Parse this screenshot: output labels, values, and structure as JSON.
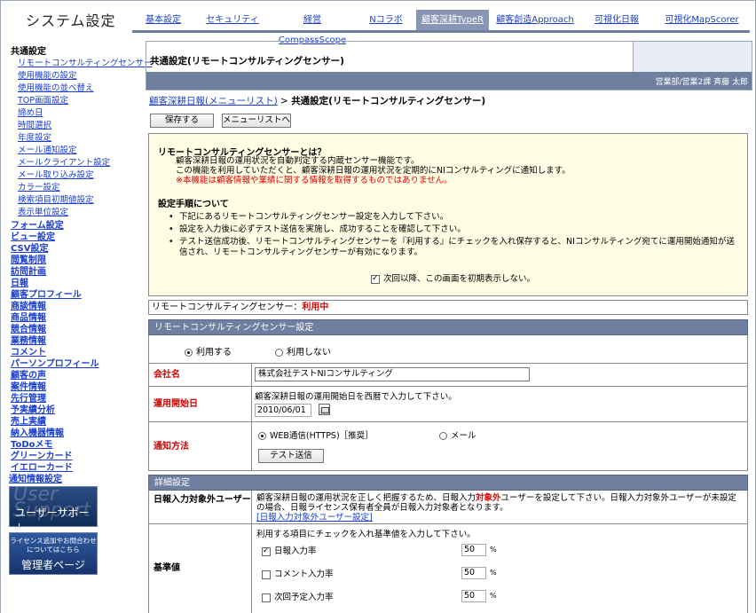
{
  "app": {
    "title": "システム設定"
  },
  "top_tabs": [
    {
      "label": "基本設定",
      "active": false
    },
    {
      "label": "セキュリティ",
      "active": false
    },
    {
      "label": "経営CompassScope",
      "active": false
    },
    {
      "label": "Nコラボ",
      "active": false
    },
    {
      "label": "顧客深耕TypeR",
      "active": true
    },
    {
      "label": "顧客創造Approach",
      "active": false
    },
    {
      "label": "可視化日報",
      "active": false
    },
    {
      "label": "可視化MapScorer",
      "active": false
    }
  ],
  "sidebar": {
    "common_head": "共通設定",
    "common_items": [
      "リモートコンサルティングセンサー",
      "使用機能の設定",
      "使用機能の並べ替え",
      "TOP画面設定",
      "締め日",
      "時間選択",
      "年度設定",
      "メール通知設定",
      "メールクライアント設定",
      "メール取り込み設定",
      "カラー設定",
      "検索項目初期値設定",
      "表示単位設定"
    ],
    "main_items": [
      "フォーム設定",
      "ビュー設定",
      "CSV設定",
      "閲覧制限",
      "訪問計画",
      "日報",
      "顧客プロフィール",
      "商談情報",
      "商品情報",
      "競合情報",
      "業務情報",
      "コメント",
      "パーソンプロフィール",
      "顧客の声",
      "案件情報",
      "先行管理",
      "予実績分析",
      "売上実績",
      "納入機器情報",
      "ToDoメモ",
      "グリーンカード",
      "イエローカード",
      "通知情報設定"
    ],
    "support_banner": {
      "bg": "User Support",
      "label": "ユーザーサポート"
    },
    "admin_banner": {
      "line1": "ライセンス追加やお問合わせ",
      "line2": "についてはこちら",
      "label": "管理者ページ"
    }
  },
  "page": {
    "title": "共通設定(リモートコンサルティングセンサー)",
    "user": "営業部/営業2課 斉藤 太郎",
    "breadcrumb_link": "顧客深耕日報(メニューリスト)",
    "breadcrumb_sep": " > ",
    "breadcrumb_current": "共通設定(リモートコンサルティングセンサー)",
    "save_label": "保存する",
    "list_label": "メニューリストへ"
  },
  "info": {
    "title": "リモートコンサルティングセンサーとは？",
    "line1": "顧客深耕日報の運用状況を自動判定する内蔵センサー機能です。",
    "line2": "この機能を利用していただくと、顧客深耕日報の運用状況を定期的にNIコンサルティングに通知します。",
    "line3": "※本機能は顧客情報や業績に関する情報を取得するものではありません。",
    "steps_title": "設定手順について",
    "steps": [
      "下記にあるリモートコンサルティングセンサー設定を入力して下さい。",
      "設定を入力後に必ずテスト送信を実施し、成功することを確認して下さい。",
      "テスト送信成功後、リモートコンサルティングセンサーを『利用する』にチェックを入れ保存すると、NIコンサルティング宛てに運用開始通知が送信され、リモートコンサルティングセンサーが有効になります。"
    ],
    "no_show_label": "次回以降、この画面を初期表示しない。",
    "no_show_checked": true
  },
  "status": {
    "label": "リモートコンサルティングセンサー：",
    "value": "利用中"
  },
  "sensor": {
    "head": "リモートコンサルティングセンサー設定",
    "use_on": "利用する",
    "use_off": "利用しない",
    "use_selected": "on",
    "company_label": "会社名",
    "company_value": "株式会社テストNIコンサルティング",
    "start_label": "運用開始日",
    "start_hint": "顧客深耕日報の運用開始日を西暦で入力して下さい。",
    "start_value": "2010/06/01",
    "notify_label": "通知方法",
    "notify_web": "WEB通信(HTTPS)［推奨］",
    "notify_mail": "メール",
    "notify_selected": "web",
    "test_label": "テスト送信"
  },
  "detail": {
    "head": "詳細設定",
    "exclude_label": "日報入力対象外ユーザー",
    "exclude_text1": "顧客深耕日報の運用状況を正しく把握するため、日報入力",
    "exclude_red": "対象外",
    "exclude_text2": "ユーザーを設定して下さい。日報入力対象外ユーザーが未設定の場合、日報ライセンス保有者全員が日報入力対象者となります。",
    "exclude_link": "[日報入力対象外ユーザー設定]",
    "criteria_label": "基準値",
    "criteria_hint": "利用する項目にチェックを入れ基準値を入力して下さい。",
    "criteria": [
      {
        "label": "日報入力率",
        "checked": true,
        "value": "50",
        "unit": "%"
      },
      {
        "label": "コメント入力率",
        "checked": false,
        "value": "50",
        "unit": "%"
      },
      {
        "label": "次回予定入力率",
        "checked": false,
        "value": "50",
        "unit": "%"
      }
    ]
  }
}
